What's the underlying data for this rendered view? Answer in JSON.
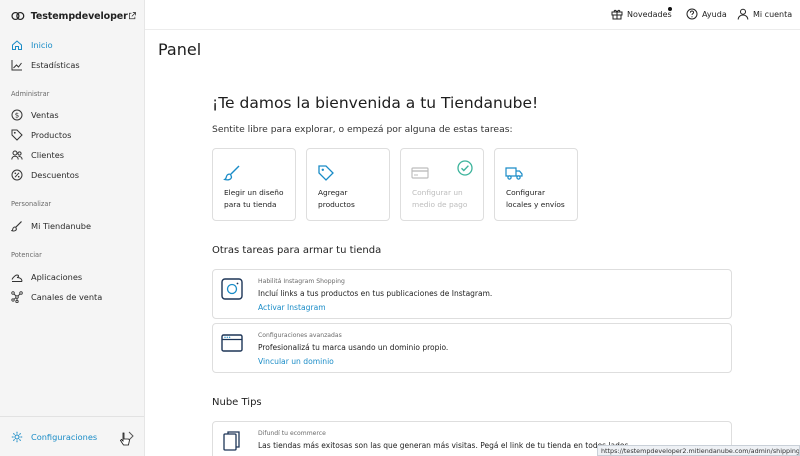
{
  "brand": {
    "name": "Testempdeveloper"
  },
  "sidebar": {
    "main": [
      {
        "label": "Inicio",
        "icon": "home-icon"
      },
      {
        "label": "Estadísticas",
        "icon": "chart-icon"
      }
    ],
    "admin_label": "Administrar",
    "admin": [
      {
        "label": "Ventas",
        "icon": "dollar-icon"
      },
      {
        "label": "Productos",
        "icon": "tag-icon"
      },
      {
        "label": "Clientes",
        "icon": "users-icon"
      },
      {
        "label": "Descuentos",
        "icon": "percent-icon"
      }
    ],
    "custom_label": "Personalizar",
    "custom": [
      {
        "label": "Mi Tiendanube",
        "icon": "brush-icon"
      }
    ],
    "power_label": "Potenciar",
    "power": [
      {
        "label": "Aplicaciones",
        "icon": "apps-icon"
      },
      {
        "label": "Canales de venta",
        "icon": "network-icon"
      }
    ],
    "settings": {
      "label": "Configuraciones",
      "icon": "gear-icon"
    }
  },
  "topbar": {
    "news": "Novedades",
    "help": "Ayuda",
    "account": "Mi cuenta"
  },
  "page_title": "Panel",
  "welcome": {
    "title": "¡Te damos la bienvenida a tu Tiendanube!",
    "subtitle": "Sentite libre para explorar, o empezá por alguna de estas tareas:"
  },
  "tasks": [
    {
      "line1": "Elegir un diseño",
      "line2": "para tu tienda",
      "done": false
    },
    {
      "line1": "Agregar",
      "line2": "productos",
      "done": false
    },
    {
      "line1": "Configurar un",
      "line2": "medio de pago",
      "done": true
    },
    {
      "line1": "Configurar",
      "line2": "locales y envíos",
      "done": false
    }
  ],
  "other_tasks_title": "Otras tareas para armar tu tienda",
  "other_tasks": [
    {
      "kicker": "Habilitá Instagram Shopping",
      "desc": "Incluí links a tus productos en tus publicaciones de Instagram.",
      "link": "Activar Instagram"
    },
    {
      "kicker": "Configuraciones avanzadas",
      "desc": "Profesionalizá tu marca usando un dominio propio.",
      "link": "Vincular un dominio"
    }
  ],
  "tips_title": "Nube Tips",
  "tips": [
    {
      "kicker": "Difundí tu ecommerce",
      "desc": "Las tiendas más exitosas son las que generan más visitas. Pegá el link de tu tienda en todos lados."
    }
  ],
  "status_url": "https://testempdeveloper2.mitiendanube.com/admin/shipping/",
  "colors": {
    "accent": "#1a8cc7",
    "success": "#3bb39b"
  }
}
